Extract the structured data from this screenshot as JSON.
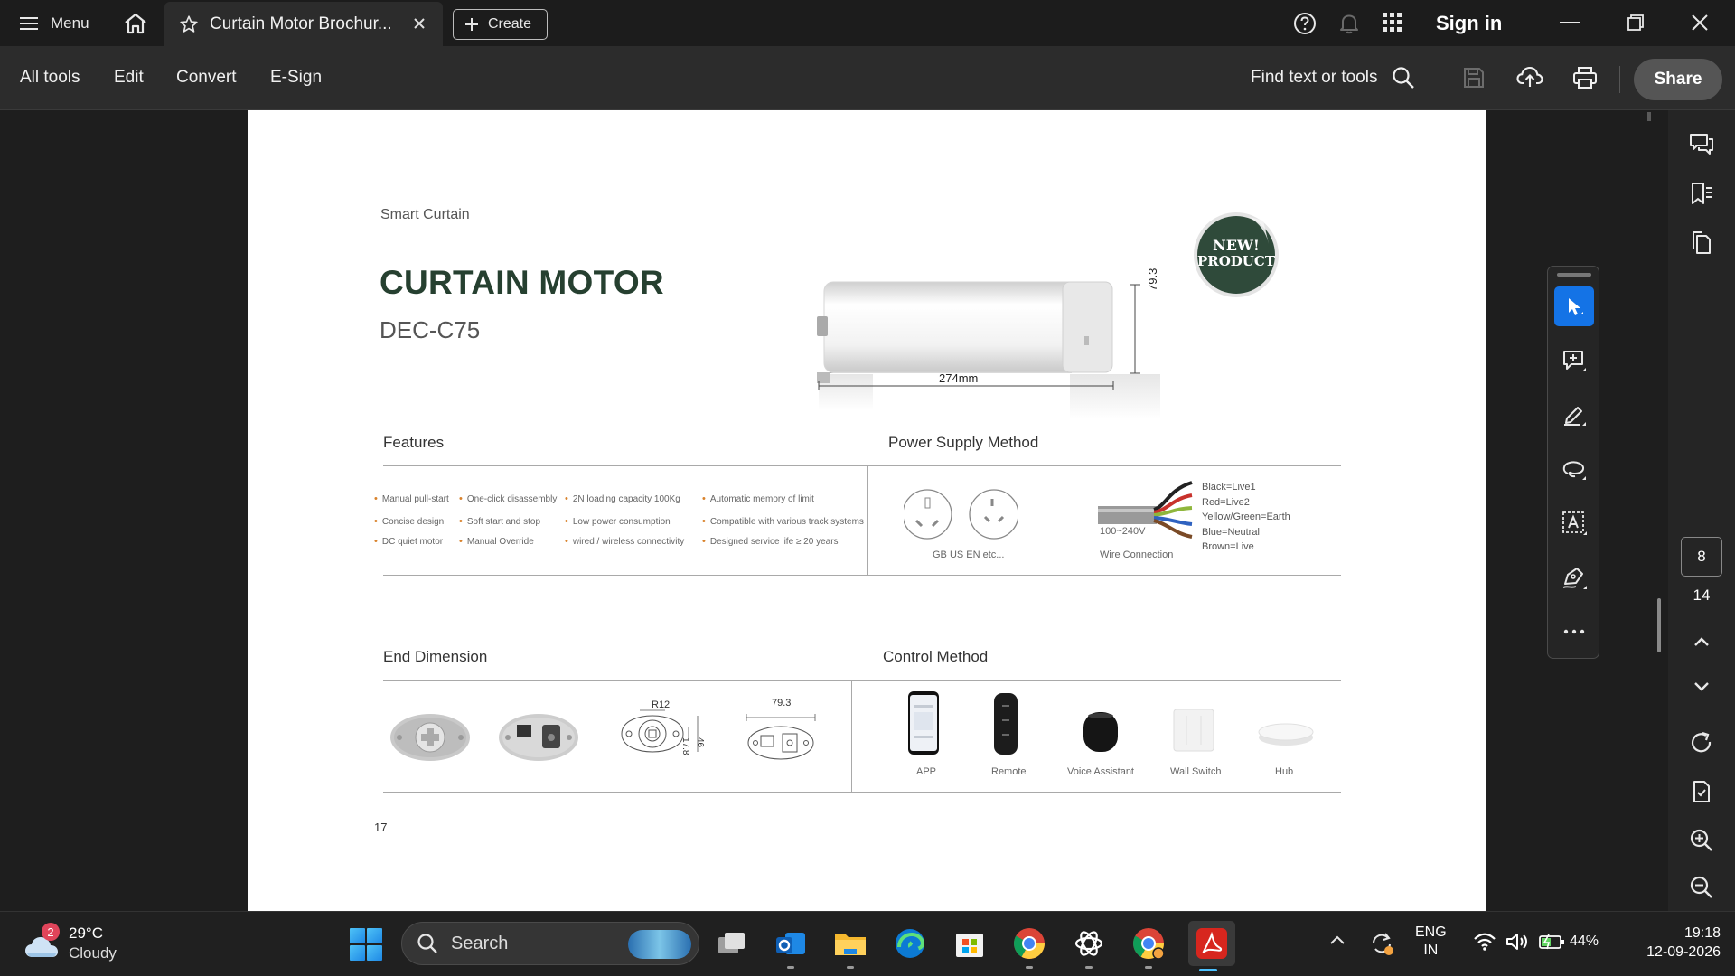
{
  "app": {
    "menu_label": "Menu",
    "tab_title": "Curtain Motor  Brochur...",
    "create_label": "Create",
    "signin_label": "Sign in"
  },
  "toolbar": {
    "all_tools": "All tools",
    "edit": "Edit",
    "convert": "Convert",
    "esign": "E-Sign",
    "find": "Find text or tools",
    "share": "Share"
  },
  "document": {
    "category": "Smart Curtain",
    "title": "CURTAIN MOTOR",
    "model": "DEC-C75",
    "length_dim": "274mm",
    "height_dim": "79.3",
    "badge_line1": "NEW!",
    "badge_line2": "PRODUCT",
    "sections": {
      "features": "Features",
      "power": "Power Supply Method",
      "end": "End Dimension",
      "control": "Control Method"
    },
    "features": [
      "Manual pull-start",
      "One-click disassembly",
      "2N loading capacity 100Kg",
      "Automatic memory of limit",
      "Concise design",
      "Soft start and stop",
      "Low power consumption",
      "Compatible with various track systems",
      "DC quiet motor",
      "Manual Override",
      "wired / wireless connectivity",
      "Designed service life ≥ 20 years"
    ],
    "power": {
      "plug_caption": "GB US EN etc...",
      "voltage": "100~240V",
      "wire_caption": "Wire Connection",
      "wires": [
        "Black=Live1",
        "Red=Live2",
        "Yellow/Green=Earth",
        "Blue=Neutral",
        "Brown=Live"
      ]
    },
    "end_dims": {
      "r_label": "R12",
      "w_label": "79.3",
      "h1_label": "17.8",
      "h2_label": "46"
    },
    "control": [
      "APP",
      "Remote",
      "Voice Assistant",
      "Wall Switch",
      "Hub"
    ],
    "page_number": "17"
  },
  "right_rail": {
    "page_current": "8",
    "page_total": "14"
  },
  "taskbar": {
    "weather_temp": "29°C",
    "weather_desc": "Cloudy",
    "weather_badge": "2",
    "search_placeholder": "Search",
    "lang_line1": "ENG",
    "lang_line2": "IN",
    "battery": "44%",
    "time": "19:18",
    "date": "12-09-2026"
  },
  "colors": {
    "accent": "#1473e6",
    "title_green": "#264030",
    "badge_green": "#2f4a3a",
    "bullet_orange": "#d9822b"
  }
}
